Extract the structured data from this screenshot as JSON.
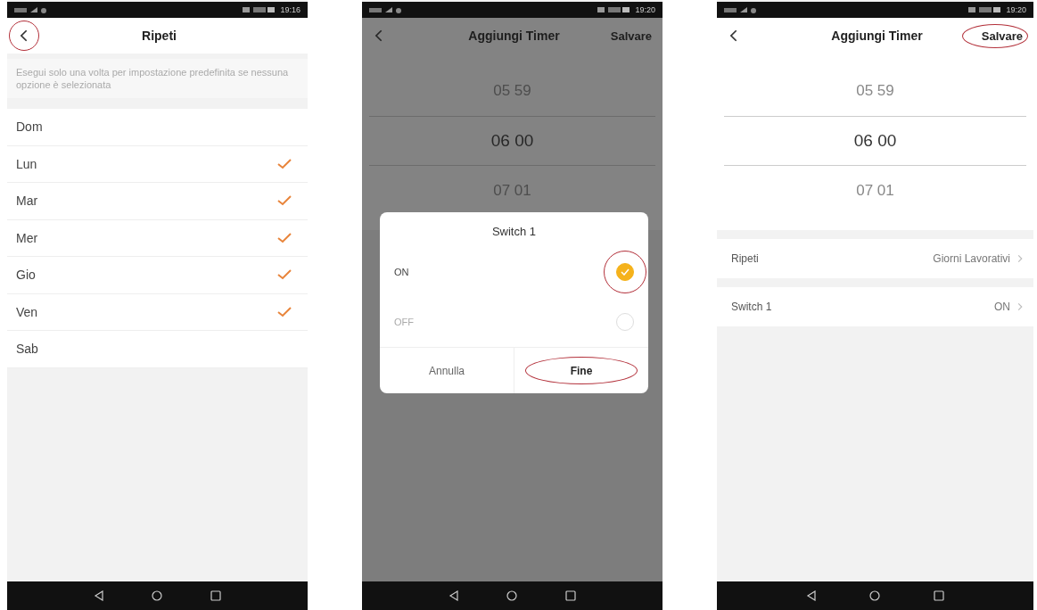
{
  "screens": [
    {
      "kind": "day-list",
      "status_bar": {
        "time": "19:16"
      },
      "header": {
        "title": "Ripeti",
        "back_circled": true
      },
      "hint": "Esegui solo una volta per impostazione predefinita se nessuna opzione è selezionata",
      "days": [
        {
          "label": "Dom",
          "checked": false
        },
        {
          "label": "Lun",
          "checked": true
        },
        {
          "label": "Mar",
          "checked": true
        },
        {
          "label": "Mer",
          "checked": true
        },
        {
          "label": "Gio",
          "checked": true
        },
        {
          "label": "Ven",
          "checked": true
        },
        {
          "label": "Sab",
          "checked": false
        }
      ]
    },
    {
      "kind": "timer",
      "dimmed": true,
      "status_bar": {
        "time": "19:20"
      },
      "header": {
        "title": "Aggiungi Timer",
        "action": "Salvare",
        "back_circled": false,
        "action_circled": false
      },
      "picker": [
        {
          "label": "05 59",
          "selected": false
        },
        {
          "label": "06 00",
          "selected": true
        },
        {
          "label": "07 01",
          "selected": false
        }
      ],
      "dialog": {
        "title": "Switch 1",
        "options": [
          {
            "label": "ON",
            "selected": true,
            "circled": true
          },
          {
            "label": "OFF",
            "selected": false,
            "circled": false
          }
        ],
        "buttons": [
          {
            "label": "Annulla",
            "circled": false
          },
          {
            "label": "Fine",
            "circled": true
          }
        ]
      }
    },
    {
      "kind": "timer",
      "dimmed": false,
      "status_bar": {
        "time": "19:20"
      },
      "header": {
        "title": "Aggiungi Timer",
        "action": "Salvare",
        "back_circled": false,
        "action_circled": true
      },
      "picker": [
        {
          "label": "05 59",
          "selected": false
        },
        {
          "label": "06 00",
          "selected": true
        },
        {
          "label": "07 01",
          "selected": false
        }
      ],
      "settings": [
        {
          "label": "Ripeti",
          "value": "Giorni Lavorativi"
        },
        {
          "label": "Switch 1",
          "value": "ON"
        }
      ]
    }
  ]
}
